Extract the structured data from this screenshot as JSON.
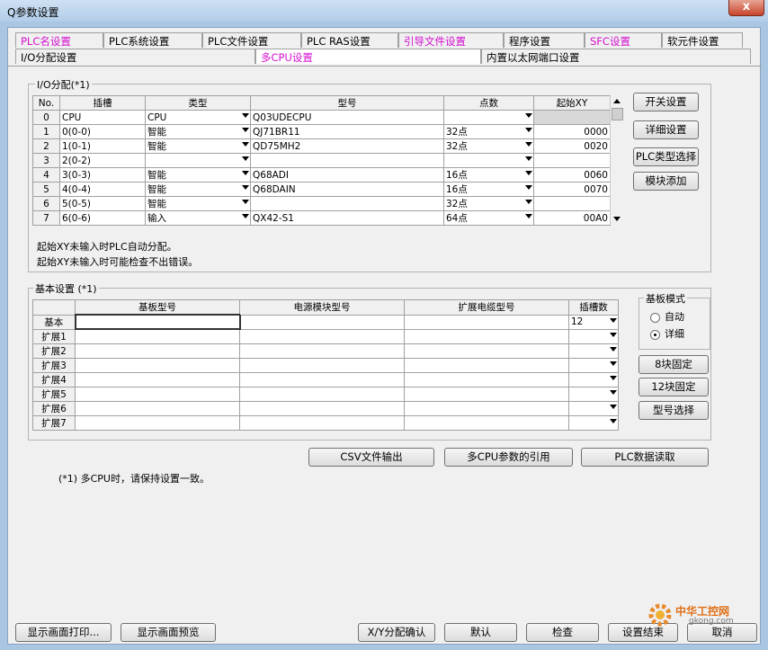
{
  "window": {
    "title": "Q参数设置",
    "close": "x"
  },
  "tabs_row1": [
    {
      "label": "PLC名设置",
      "pink": true
    },
    {
      "label": "PLC系统设置",
      "pink": false
    },
    {
      "label": "PLC文件设置",
      "pink": false
    },
    {
      "label": "PLC RAS设置",
      "pink": false
    },
    {
      "label": "引导文件设置",
      "pink": true
    },
    {
      "label": "程序设置",
      "pink": false
    },
    {
      "label": "SFC设置",
      "pink": true
    },
    {
      "label": "软元件设置",
      "pink": false
    }
  ],
  "tabs_row2": [
    {
      "label": "I/O分配设置",
      "pink": false
    },
    {
      "label": "多CPU设置",
      "pink": true
    },
    {
      "label": "内置以太网端口设置",
      "pink": false
    }
  ],
  "io": {
    "title": "I/O分配(*1)",
    "headers": [
      "No.",
      "插槽",
      "类型",
      "型号",
      "点数",
      "起始XY"
    ],
    "rows": [
      {
        "no": "0",
        "slot": "CPU",
        "type": "CPU",
        "model": "Q03UDECPU",
        "points": "",
        "start": ""
      },
      {
        "no": "1",
        "slot": "0(0-0)",
        "type": "智能",
        "model": "QJ71BR11",
        "points": "32点",
        "start": "0000"
      },
      {
        "no": "2",
        "slot": "1(0-1)",
        "type": "智能",
        "model": "QD75MH2",
        "points": "32点",
        "start": "0020"
      },
      {
        "no": "3",
        "slot": "2(0-2)",
        "type": "",
        "model": "",
        "points": "",
        "start": ""
      },
      {
        "no": "4",
        "slot": "3(0-3)",
        "type": "智能",
        "model": "Q68ADI",
        "points": "16点",
        "start": "0060"
      },
      {
        "no": "5",
        "slot": "4(0-4)",
        "type": "智能",
        "model": "Q68DAIN",
        "points": "16点",
        "start": "0070"
      },
      {
        "no": "6",
        "slot": "5(0-5)",
        "type": "智能",
        "model": "",
        "points": "32点",
        "start": ""
      },
      {
        "no": "7",
        "slot": "6(0-6)",
        "type": "输入",
        "model": "QX42-S1",
        "points": "64点",
        "start": "00A0"
      }
    ],
    "note1": "起始XY未输入时PLC自动分配。",
    "note2": "起始XY未输入时可能检查不出错误。",
    "buttons": [
      "开关设置",
      "详细设置",
      "PLC类型选择",
      "模块添加"
    ]
  },
  "base": {
    "title": "基本设置 (*1)",
    "headers": [
      "",
      "基板型号",
      "电源模块型号",
      "扩展电缆型号",
      "插槽数"
    ],
    "rows": [
      {
        "label": "基本",
        "slots": "12"
      },
      {
        "label": "扩展1",
        "slots": ""
      },
      {
        "label": "扩展2",
        "slots": ""
      },
      {
        "label": "扩展3",
        "slots": ""
      },
      {
        "label": "扩展4",
        "slots": ""
      },
      {
        "label": "扩展5",
        "slots": ""
      },
      {
        "label": "扩展6",
        "slots": ""
      },
      {
        "label": "扩展7",
        "slots": ""
      }
    ],
    "mode_title": "基板模式",
    "mode_auto": "自动",
    "mode_detail": "详细",
    "buttons": [
      "8块固定",
      "12块固定",
      "型号选择"
    ]
  },
  "mid_buttons": [
    "CSV文件输出",
    "多CPU参数的引用",
    "PLC数据读取"
  ],
  "footnote": "(*1) 多CPU时，请保持设置一致。",
  "bottom_buttons": [
    "显示画面打印...",
    "显示画面预览",
    "X/Y分配确认",
    "默认",
    "检查",
    "设置结束",
    "取消"
  ],
  "watermark": {
    "text": "中华工控网",
    "site": "gkong.com"
  }
}
